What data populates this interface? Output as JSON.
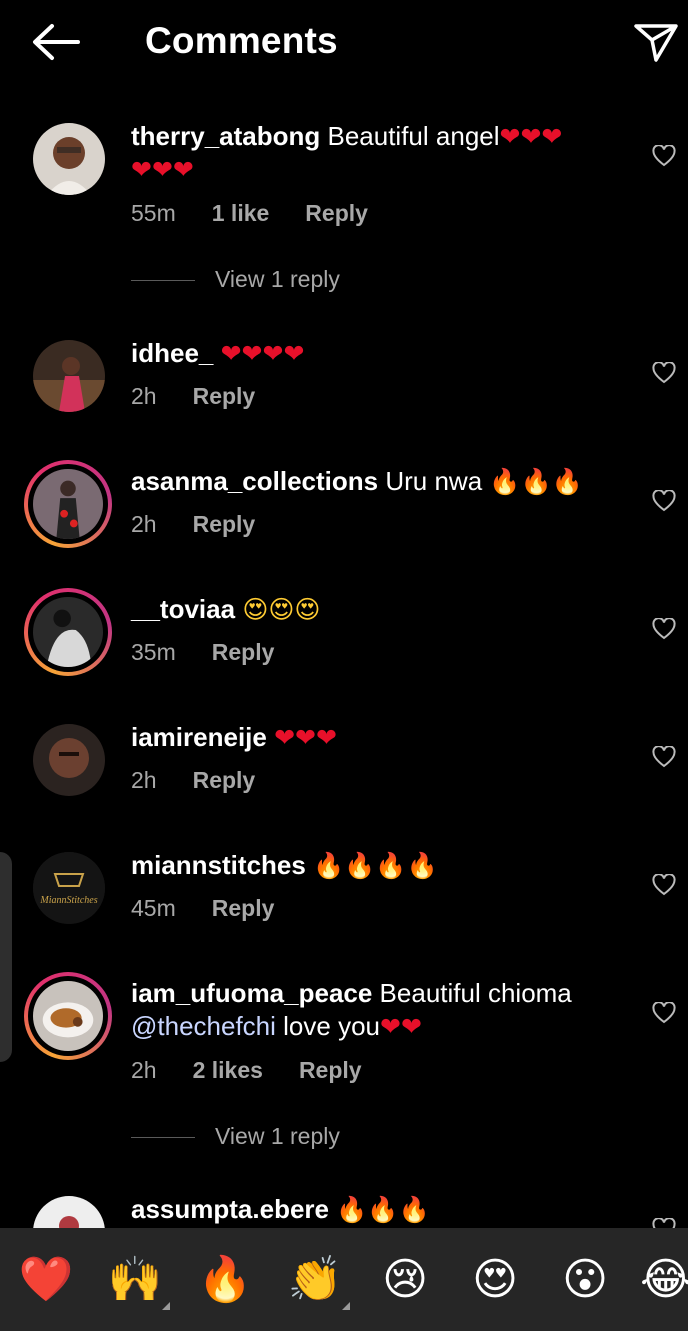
{
  "header": {
    "title": "Comments",
    "back_icon": "arrow-left-icon",
    "share_icon": "paper-plane-icon"
  },
  "comments": [
    {
      "username": "therry_atabong",
      "text": " Beautiful angel",
      "emojis": "❤❤❤",
      "emojis2": "❤❤❤",
      "time": "55m",
      "likes": "1 like",
      "reply": "Reply",
      "view_replies": "View 1 reply"
    },
    {
      "username": "idhee_",
      "text": " ",
      "emojis": "❤❤❤❤",
      "time": "2h",
      "reply": "Reply"
    },
    {
      "username": "asanma_collections",
      "text": " Uru nwa ",
      "emojis": "🔥🔥🔥",
      "time": "2h",
      "reply": "Reply"
    },
    {
      "username": "__toviaa",
      "text": " ",
      "emojis": "😍😍😍",
      "time": "35m",
      "reply": "Reply"
    },
    {
      "username": "iamireneije",
      "text": " ",
      "emojis": "❤❤❤",
      "time": "2h",
      "reply": "Reply"
    },
    {
      "username": "miannstitches",
      "text": " ",
      "emojis": "🔥🔥🔥🔥",
      "time": "45m",
      "reply": "Reply",
      "avatar_text": "MiannStitches"
    },
    {
      "username": "iam_ufuoma_peace",
      "text": " Beautiful chioma",
      "mention": "@thechefchi",
      "text2": "  love you",
      "emojis": "❤❤",
      "time": "2h",
      "likes": "2 likes",
      "reply": "Reply",
      "view_replies": "View 1 reply"
    },
    {
      "username": "assumpta.ebere",
      "text": " ",
      "emojis": "🔥🔥🔥"
    }
  ],
  "emoji_bar": [
    "❤️",
    "🙌",
    "🔥",
    "👏",
    "😢",
    "😍",
    "😮",
    "😂"
  ],
  "colors": {
    "background": "#000000",
    "meta_text": "#a8a8a8",
    "heart": "#e8102a",
    "emoji_bar_bg": "#262626"
  }
}
